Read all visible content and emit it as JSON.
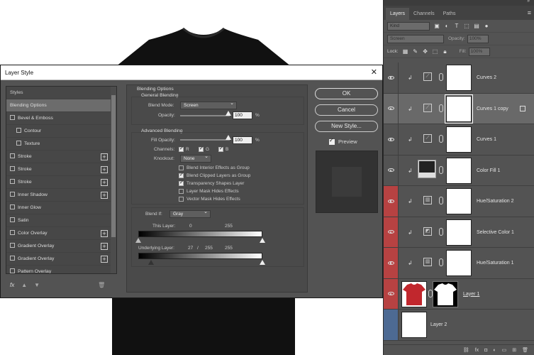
{
  "dialog": {
    "title": "Layer Style",
    "styles_list": [
      {
        "label": "Styles",
        "type": "header"
      },
      {
        "label": "Blending Options",
        "type": "selected"
      },
      {
        "label": "Bevel & Emboss",
        "type": "check"
      },
      {
        "label": "Contour",
        "type": "sub"
      },
      {
        "label": "Texture",
        "type": "sub"
      },
      {
        "label": "Stroke",
        "type": "plus"
      },
      {
        "label": "Stroke",
        "type": "plus"
      },
      {
        "label": "Stroke",
        "type": "plus"
      },
      {
        "label": "Inner Shadow",
        "type": "plus"
      },
      {
        "label": "Inner Glow",
        "type": "check"
      },
      {
        "label": "Satin",
        "type": "check"
      },
      {
        "label": "Color Overlay",
        "type": "plus"
      },
      {
        "label": "Gradient Overlay",
        "type": "plus"
      },
      {
        "label": "Gradient Overlay",
        "type": "plus"
      },
      {
        "label": "Pattern Overlay",
        "type": "check"
      }
    ],
    "footer_fx": "fx",
    "blending": {
      "section_title": "Blending Options",
      "general_title": "General Blending",
      "blend_mode_label": "Blend Mode:",
      "blend_mode_value": "Screen",
      "opacity_label": "Opacity:",
      "opacity_value": "100",
      "pct": "%",
      "advanced_title": "Advanced Blending",
      "fill_opacity_label": "Fill Opacity:",
      "fill_opacity_value": "100",
      "channels_label": "Channels:",
      "channel_r": "R",
      "channel_g": "G",
      "channel_b": "B",
      "knockout_label": "Knockout:",
      "knockout_value": "None",
      "checks": [
        {
          "label": "Blend Interior Effects as Group",
          "on": false
        },
        {
          "label": "Blend Clipped Layers as Group",
          "on": true
        },
        {
          "label": "Transparency Shapes Layer",
          "on": true
        },
        {
          "label": "Layer Mask Hides Effects",
          "on": false
        },
        {
          "label": "Vector Mask Hides Effects",
          "on": false
        }
      ],
      "blend_if_label": "Blend If:",
      "blend_if_value": "Gray",
      "this_layer_label": "This Layer:",
      "this_layer_low": "0",
      "this_layer_high": "255",
      "underlying_label": "Underlying Layer:",
      "underlying_low": "27",
      "underlying_sep": "/",
      "underlying_mid": "255",
      "underlying_high": "255"
    },
    "buttons": {
      "ok": "OK",
      "cancel": "Cancel",
      "new_style": "New Style...",
      "preview": "Preview"
    }
  },
  "layers_panel": {
    "tabs": [
      "Layers",
      "Channels",
      "Paths"
    ],
    "kind_placeholder": "Kind",
    "blend_mode": "Screen",
    "opacity_label": "Opacity:",
    "opacity_value": "100%",
    "lock_label": "Lock:",
    "fill_label": "Fill:",
    "fill_value": "100%",
    "layers": [
      {
        "name": "Curves 2",
        "type": "adj",
        "icon": "curves-icon",
        "color": "none"
      },
      {
        "name": "Curves 1 copy",
        "type": "adj",
        "icon": "curves-icon",
        "color": "none",
        "selected": true
      },
      {
        "name": "Curves 1",
        "type": "adj",
        "icon": "curves-icon",
        "color": "none"
      },
      {
        "name": "Color Fill 1",
        "type": "fill",
        "icon": "color-fill-icon",
        "color": "none"
      },
      {
        "name": "Hue/Saturation 2",
        "type": "adj",
        "icon": "hue-sat-icon",
        "color": "red"
      },
      {
        "name": "Selective Color 1",
        "type": "adj",
        "icon": "selective-color-icon",
        "color": "red"
      },
      {
        "name": "Hue/Saturation 1",
        "type": "adj",
        "icon": "hue-sat-icon",
        "color": "red"
      },
      {
        "name": "Layer 1",
        "type": "pixel-mask",
        "icon": "tshirt-icon",
        "color": "red"
      },
      {
        "name": "Layer 2",
        "type": "pixel",
        "icon": "none",
        "color": "blue"
      }
    ]
  }
}
